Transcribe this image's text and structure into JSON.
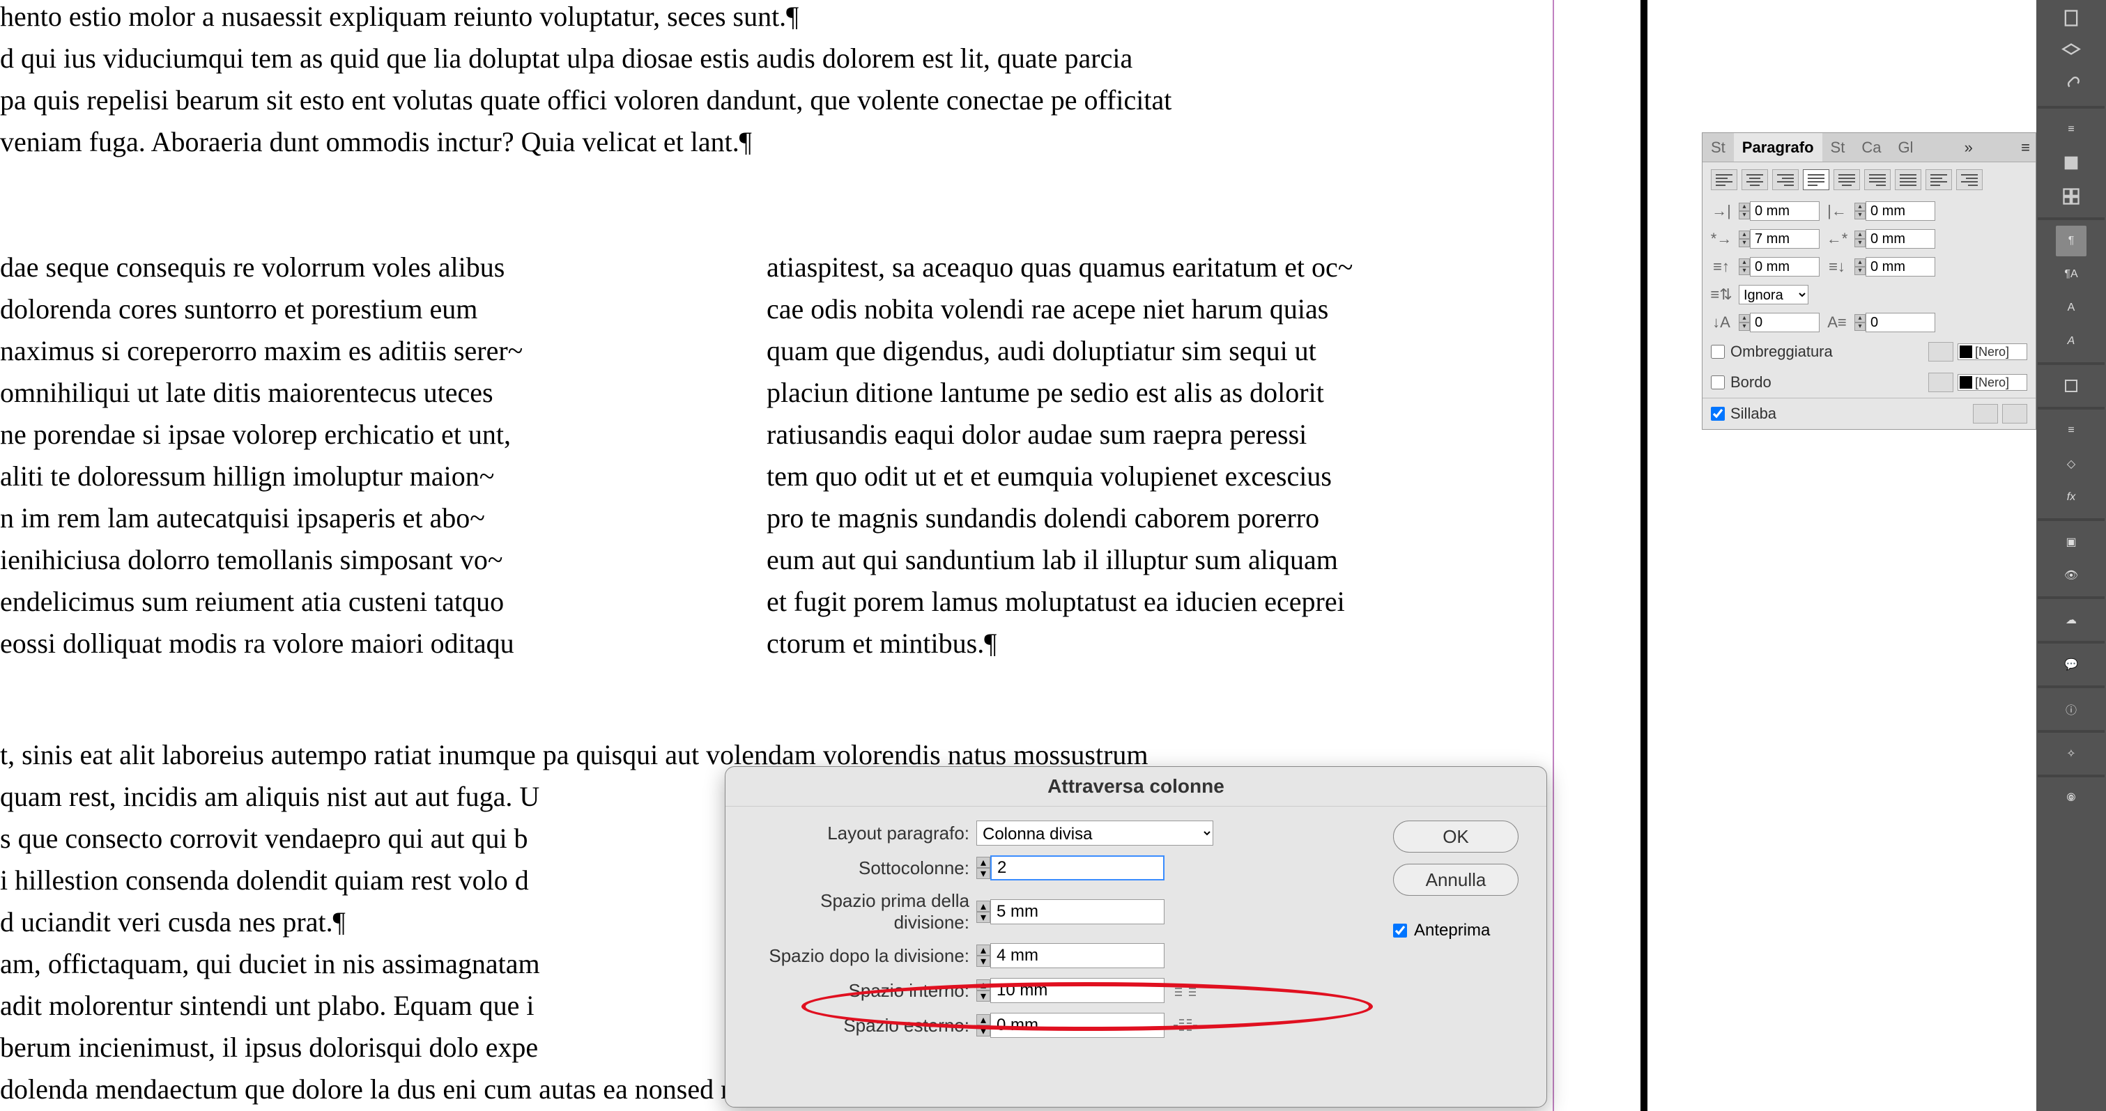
{
  "document": {
    "lines_full": [
      "hento estio molor a nusaessit expliquam reiunto voluptatur, seces sunt.¶",
      "d qui ius viduciumqui tem as quid que lia doluptat ulpa diosae estis audis dolorem est lit, quate parcia",
      "pa quis repelisi bearum sit esto ent volutas quate offici voloren dandunt, que volente conectae pe officitat",
      "veniam fuga. Aboraeria dunt ommodis inctur? Quia velicat et lant.¶"
    ],
    "col1": [
      "dae seque consequis re volorrum voles alibus",
      "dolorenda cores suntorro et porestium eum",
      "naximus si coreperorro maxim es aditiis serer~",
      "omnihiliqui ut late ditis maiorentecus uteces",
      "ne porendae si ipsae volorep erchicatio et unt,",
      "aliti te doloressum hillign imoluptur maion~",
      "n im rem lam autecatquisi ipsaperis et abo~",
      "ienihiciusa dolorro temollanis simposant vo~",
      "endelicimus sum reiument atia custeni tatquo",
      "eossi dolliquat modis ra volore maiori oditaqu"
    ],
    "col2": [
      "atiaspitest, sa aceaquo quas quamus earitatum et oc~",
      "cae odis nobita volendi rae acepe niet harum quias",
      "quam que digendus, audi doluptiatur sim sequi ut",
      "placiun ditione lantume pe sedio est alis as dolorit",
      "ratiusandis eaqui dolor audae sum raepra peressi",
      "tem quo odit ut et et eumquia volupienet excescius",
      "pro te magnis sundandis dolendi caborem porerro",
      "eum aut qui sanduntium lab il illuptur sum aliquam",
      "et fugit porem lamus moluptatust ea iducien eceprei",
      "ctorum et mintibus.¶"
    ],
    "lines_bottom": [
      "t, sinis eat alit laboreius autempo ratiat inumque pa quisqui aut volendam volorendis natus mossustrum",
      "quam rest, incidis am aliquis nist aut aut fuga. U",
      "s que consecto corrovit vendaepro qui aut qui b",
      "i hillestion consenda dolendit quiam rest volo d",
      "d uciandit veri cusda nes prat.¶",
      "am, offictaquam, qui duciet in nis assimagnatam",
      "adit molorentur sintendi unt plabo. Equam que i",
      "berum incienimust, il ipsus dolorisqui dolo expe",
      "dolenda mendaectum que dolore la dus eni cum autas ea nonsed moluptiat essimpernit assitemperia"
    ]
  },
  "paragrafo_panel": {
    "tabs": {
      "st1": "St",
      "active": "Paragrafo",
      "st2": "St",
      "ca": "Ca",
      "gl": "Gl"
    },
    "indent_left": "0 mm",
    "indent_right": "0 mm",
    "first_line": "7 mm",
    "last_line": "0 mm",
    "space_before": "0 mm",
    "space_after": "0 mm",
    "auto_leading": "Ignora",
    "dropcap_lines": "0",
    "dropcap_chars": "0",
    "ombreggiatura": "Ombreggiatura",
    "bordo": "Bordo",
    "color1": "[Nero]",
    "color2": "[Nero]",
    "sillaba": "Sillaba"
  },
  "dialog": {
    "title": "Attraversa colonne",
    "fields": {
      "layout_label": "Layout paragrafo:",
      "layout_value": "Colonna divisa",
      "sottocolonne_label": "Sottocolonne:",
      "sottocolonne_value": "2",
      "spazio_prima_label": "Spazio prima della divisione:",
      "spazio_prima_value": "5 mm",
      "spazio_dopo_label": "Spazio dopo la divisione:",
      "spazio_dopo_value": "4 mm",
      "spazio_interno_label": "Spazio interno:",
      "spazio_interno_value": "10 mm",
      "spazio_esterno_label": "Spazio esterno:",
      "spazio_esterno_value": "0 mm"
    },
    "buttons": {
      "ok": "OK",
      "annulla": "Annulla"
    },
    "anteprima": "Anteprima"
  }
}
